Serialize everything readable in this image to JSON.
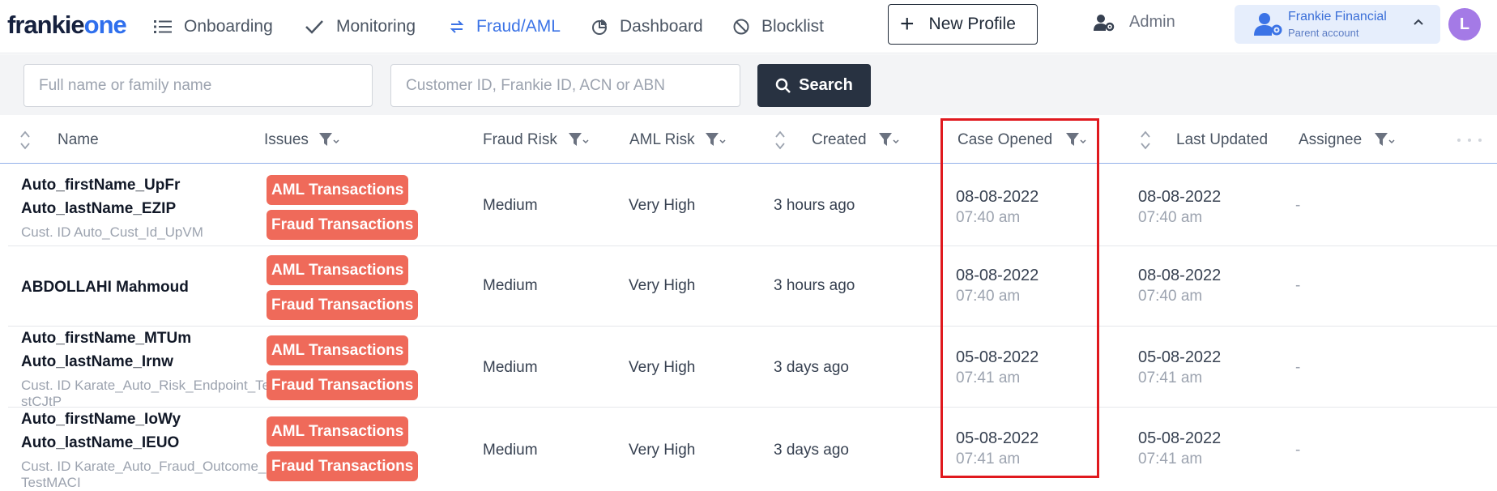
{
  "brand": {
    "logo_part1": "frankie",
    "logo_part2": "one"
  },
  "nav": {
    "onboarding": "Onboarding",
    "monitoring": "Monitoring",
    "fraud_aml": "Fraud/AML",
    "dashboard": "Dashboard",
    "blocklist": "Blocklist"
  },
  "new_profile": {
    "plus": "+",
    "label": "New Profile"
  },
  "admin": {
    "label": "Admin"
  },
  "account": {
    "name": "Frankie Financial",
    "subtitle": "Parent account"
  },
  "avatar": {
    "initial": "L"
  },
  "search": {
    "name_placeholder": "Full name or family name",
    "id_placeholder": "Customer ID, Frankie ID, ACN or ABN",
    "button_label": "Search"
  },
  "columns": {
    "name": "Name",
    "issues": "Issues",
    "fraud_risk": "Fraud Risk",
    "aml_risk": "AML Risk",
    "created": "Created",
    "case_opened": "Case Opened",
    "last_updated": "Last Updated",
    "assignee": "Assignee"
  },
  "rows": [
    {
      "name_line1": "Auto_firstName_UpFr",
      "name_line2": "Auto_lastName_EZIP",
      "cust_id": "Cust. ID Auto_Cust_Id_UpVM",
      "issue1": "AML Transactions",
      "issue2": "Fraud Transactions",
      "fraud_risk": "Medium",
      "aml_risk": "Very High",
      "created": "3 hours ago",
      "case_opened_date": "08-08-2022",
      "case_opened_time": "07:40 am",
      "last_updated_date": "08-08-2022",
      "last_updated_time": "07:40 am",
      "assignee": "-"
    },
    {
      "name_line1": "ABDOLLAHI Mahmoud",
      "issue1": "AML Transactions",
      "issue2": "Fraud Transactions",
      "fraud_risk": "Medium",
      "aml_risk": "Very High",
      "created": "3 hours ago",
      "case_opened_date": "08-08-2022",
      "case_opened_time": "07:40 am",
      "last_updated_date": "08-08-2022",
      "last_updated_time": "07:40 am",
      "assignee": "-"
    },
    {
      "name_line1": "Auto_firstName_MTUm",
      "name_line2": "Auto_lastName_Irnw",
      "cust_id": "Cust. ID Karate_Auto_Risk_Endpoint_TestCJtP",
      "issue1": "AML Transactions",
      "issue2": "Fraud Transactions",
      "fraud_risk": "Medium",
      "aml_risk": "Very High",
      "created": "3 days ago",
      "case_opened_date": "05-08-2022",
      "case_opened_time": "07:41 am",
      "last_updated_date": "05-08-2022",
      "last_updated_time": "07:41 am",
      "assignee": "-"
    },
    {
      "name_line1": "Auto_firstName_IoWy",
      "name_line2": "Auto_lastName_IEUO",
      "cust_id": "Cust. ID Karate_Auto_Fraud_Outcome_TestMACI",
      "issue1": "AML Transactions",
      "issue2": "Fraud Transactions",
      "fraud_risk": "Medium",
      "aml_risk": "Very High",
      "created": "3 days ago",
      "case_opened_date": "05-08-2022",
      "case_opened_time": "07:41 am",
      "last_updated_date": "05-08-2022",
      "last_updated_time": "07:41 am",
      "assignee": "-"
    }
  ],
  "colors": {
    "accent": "#3b73e6",
    "tag": "#ef6a5a",
    "highlight": "#e0191e",
    "search_button": "#283241"
  }
}
